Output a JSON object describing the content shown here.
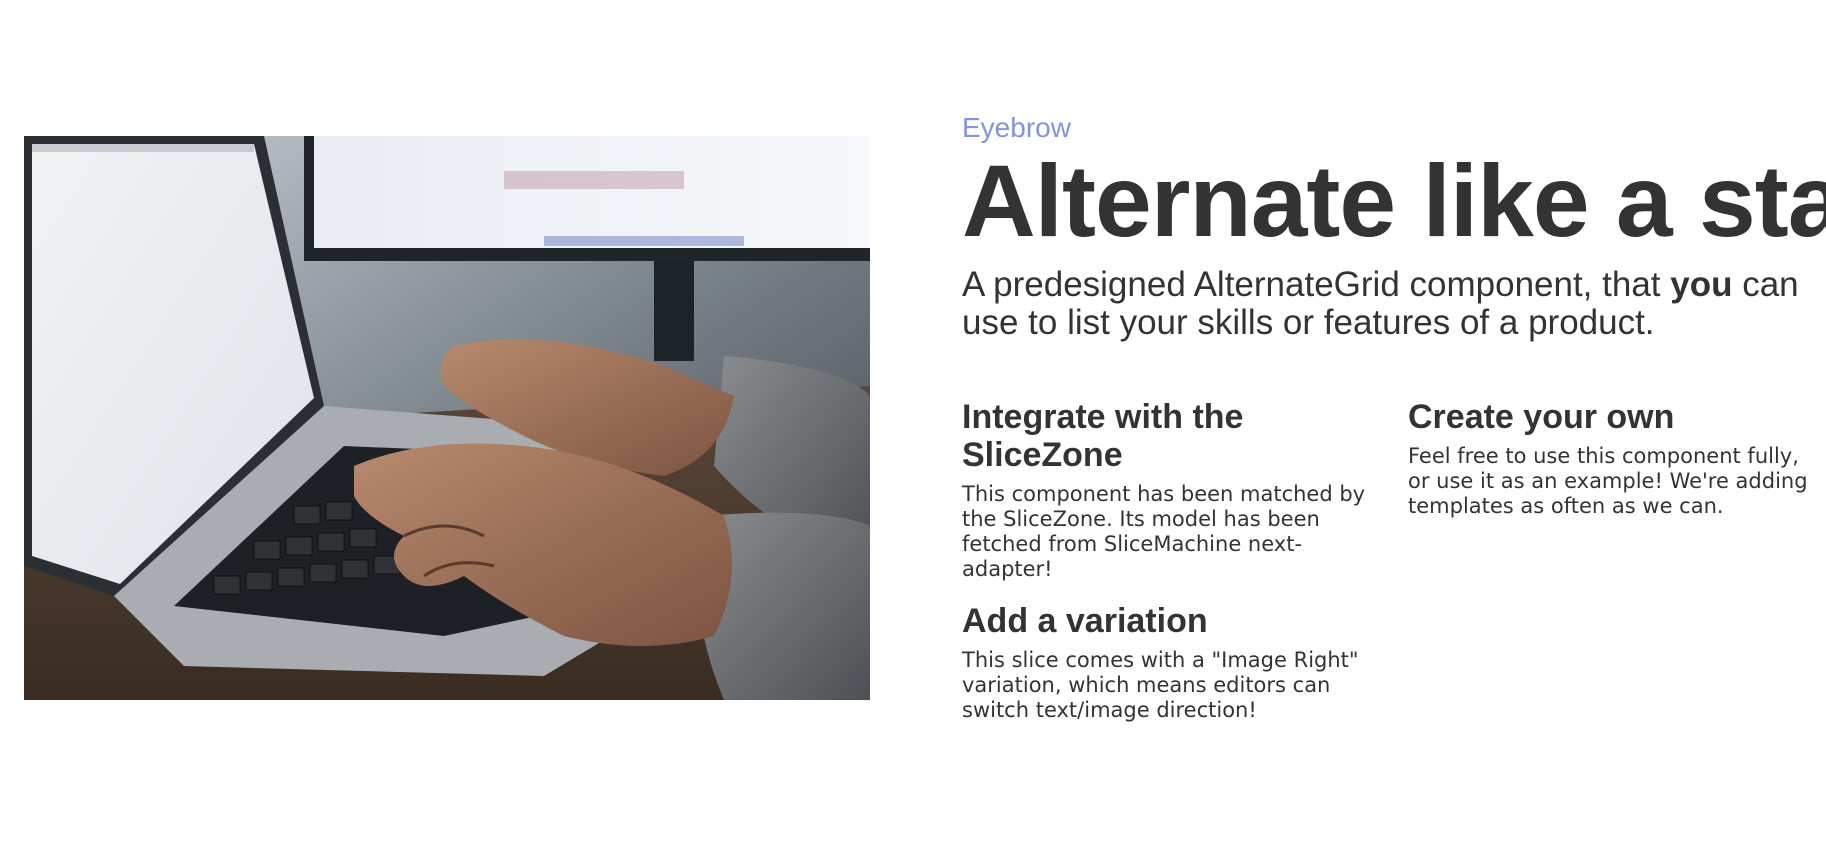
{
  "slice": {
    "eyebrow": "Eyebrow",
    "title": "Alternate like a star",
    "description": {
      "before": "A predesigned AlternateGrid component, that ",
      "emphasis": "you",
      "after": " can use to list your skills or features of a product."
    },
    "image": {
      "alt": "Hands typing on a laptop keyboard"
    },
    "items": [
      {
        "title": "Integrate with the SliceZone",
        "description": "This component has been matched by the SliceZone. Its model has been fetched from SliceMachine next-adapter!"
      },
      {
        "title": "Create your own",
        "description": "Feel free to use this component fully, or use it as an example! We're adding templates as often as we can."
      },
      {
        "title": "Add a variation",
        "description": "This slice comes with a \"Image Right\" variation, which means editors can switch text/image direction!"
      }
    ]
  },
  "colors": {
    "eyebrow": "#8592e0",
    "text": "#333333",
    "background": "#ffffff"
  }
}
